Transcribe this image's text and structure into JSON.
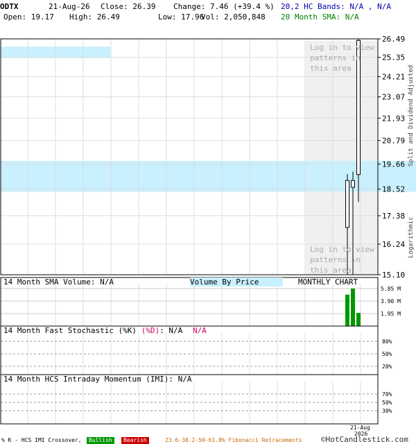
{
  "header": {
    "symbol": "ODTX",
    "date": "21-Aug-26",
    "close": "Close: 26.39",
    "change": "Change: 7.46 (+39.4 %)",
    "open": "Open: 19.17",
    "high": "High: 26.49",
    "low": "Low: 17.96",
    "vol": "Vol: 2,050,848",
    "hc_bands": "20,2 HC Bands: N/A , N/A",
    "sma20": "20 Month SMA: N/A"
  },
  "colors": {
    "hc_bands": "#0000aa",
    "sma20": "#008000",
    "band_fill": "#c8f0ff",
    "pattern_fill": "#f0f0f0",
    "volume": "#009900",
    "bullish": "#009900",
    "bearish": "#cc0000",
    "fib": "#cc6600",
    "stoch_d": "#cc0066"
  },
  "main_chart": {
    "pattern_notice": "Log in to view patterns in this area",
    "side_label_top": "Split and Dividend Adjusted",
    "side_label_bottom": "Logarithmic"
  },
  "volume_panel": {
    "sma_label": "14 Month SMA Volume: N/A",
    "vbp_label": "Volume By Price",
    "chart_type": "MONTHLY CHART"
  },
  "stoch_panel": {
    "label": "14 Month Fast Stochastic (%K)",
    "d_label": "(%D)",
    "value": ": N/A",
    "d_value": "N/A"
  },
  "imi_panel": {
    "label": "14 Month HCS Intraday Momentum (IMI): N/A"
  },
  "footer": {
    "crossover": "% K - HCS IMI Crossover,",
    "bullish": "Bullish",
    "bearish": "Bearish",
    "fib": "23.6-38.2-50-61.8% Fibonacci Retracements",
    "copyright": "©HotCandlestick.com"
  },
  "chart_data": [
    {
      "type": "candlestick",
      "scale": "log",
      "ylim": [
        15.1,
        26.49
      ],
      "yticks": [
        26.49,
        25.35,
        24.21,
        23.07,
        21.93,
        20.79,
        19.66,
        18.52,
        17.38,
        16.24,
        15.1
      ],
      "x": [
        "2026-06",
        "2026-07",
        "2026-08"
      ],
      "xtick_labels": [
        "21-Aug",
        "2026"
      ],
      "candles": [
        {
          "open": 16.9,
          "high": 19.2,
          "low": 15.1,
          "close": 18.9
        },
        {
          "open": 18.6,
          "high": 19.3,
          "low": 15.1,
          "close": 18.9
        },
        {
          "open": 19.17,
          "high": 26.49,
          "low": 17.96,
          "close": 26.39
        }
      ],
      "bands": [
        {
          "from": 25.3,
          "to": 26.0,
          "x_extent": "left"
        },
        {
          "from": 18.4,
          "to": 19.8,
          "x_extent": "full"
        }
      ],
      "grid": true
    },
    {
      "type": "bar",
      "name": "Volume",
      "ylim": [
        0,
        6.6
      ],
      "yticks": [
        5.85,
        3.9,
        1.95
      ],
      "ytick_labels": [
        "5.85 M",
        "3.90 M",
        "1.95 M"
      ],
      "values": [
        4.9,
        5.85,
        2.05
      ]
    },
    {
      "type": "line",
      "name": "Fast Stochastic",
      "yticks": [
        80,
        50,
        20
      ],
      "ytick_labels": [
        "80%",
        "50%",
        "20%"
      ],
      "values": []
    },
    {
      "type": "line",
      "name": "IMI",
      "yticks": [
        70,
        50,
        30
      ],
      "ytick_labels": [
        "70%",
        "50%",
        "30%"
      ],
      "values": []
    }
  ]
}
